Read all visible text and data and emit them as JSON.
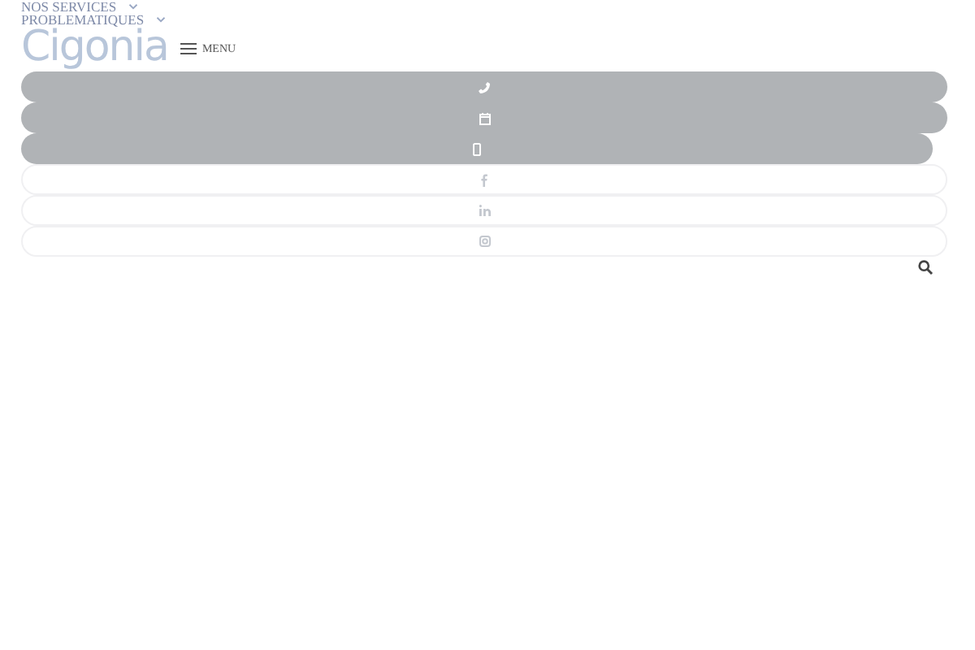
{
  "nav": [
    {
      "label": "NOS SERVICES"
    },
    {
      "label": "PROBLEMATIQUES"
    }
  ],
  "logo": "Cigonia",
  "menu": {
    "label": "MENU"
  },
  "buttons": [
    {
      "kind": "phone",
      "filled": true
    },
    {
      "kind": "calendar",
      "filled": true
    },
    {
      "kind": "mobile",
      "filled": true
    },
    {
      "kind": "facebook",
      "filled": false
    },
    {
      "kind": "linkedin",
      "filled": false
    },
    {
      "kind": "instagram",
      "filled": false
    }
  ]
}
